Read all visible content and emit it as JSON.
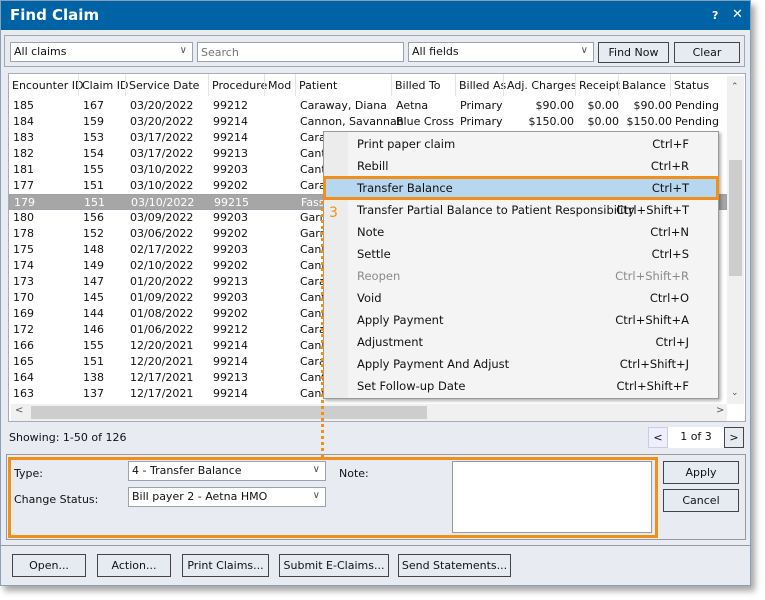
{
  "window": {
    "title": "Find Claim",
    "help": "?",
    "close": "✕"
  },
  "toolbar": {
    "filter": "All claims",
    "search_placeholder": "Search",
    "fields": "All fields",
    "find_now": "Find Now",
    "clear": "Clear"
  },
  "columns": [
    "Encounter ID",
    "Claim ID",
    "Service Date",
    "Procedure",
    "Mod",
    "Patient",
    "Billed To",
    "Billed As",
    "Adj. Charges",
    "Receipt",
    "Balance",
    "Status"
  ],
  "rows": [
    [
      "185",
      "167",
      "03/20/2022",
      "99212",
      "",
      "Caraway, Diana",
      "Aetna",
      "Primary",
      "$90.00",
      "$0.00",
      "$90.00",
      "Pending"
    ],
    [
      "184",
      "159",
      "03/20/2022",
      "99214",
      "",
      "Cannon, Savannah",
      "Blue Cross",
      "Primary",
      "$150.00",
      "$0.00",
      "$150.00",
      "Pending"
    ],
    [
      "183",
      "153",
      "03/17/2022",
      "99214",
      "",
      "Cara"
    ],
    [
      "182",
      "154",
      "03/17/2022",
      "99213",
      "",
      "Cant"
    ],
    [
      "181",
      "155",
      "03/10/2022",
      "99203",
      "",
      "Cant"
    ],
    [
      "177",
      "151",
      "03/10/2022",
      "99202",
      "",
      "Cara"
    ],
    [
      "179",
      "151",
      "03/10/2022",
      "99215",
      "",
      "Fass"
    ],
    [
      "180",
      "156",
      "03/09/2022",
      "99203",
      "",
      "Garr"
    ],
    [
      "178",
      "152",
      "03/06/2022",
      "99202",
      "",
      "Garr"
    ],
    [
      "175",
      "148",
      "02/17/2022",
      "99203",
      "",
      "Cann"
    ],
    [
      "174",
      "149",
      "02/10/2022",
      "99202",
      "",
      "Cann"
    ],
    [
      "173",
      "147",
      "01/20/2022",
      "99213",
      "",
      "Cara"
    ],
    [
      "170",
      "145",
      "01/09/2022",
      "99203",
      "",
      "Cant"
    ],
    [
      "169",
      "144",
      "01/08/2022",
      "99202",
      "",
      "Cant"
    ],
    [
      "172",
      "146",
      "01/06/2022",
      "99212",
      "",
      "Cara"
    ],
    [
      "166",
      "155",
      "12/20/2021",
      "99214",
      "",
      "Cann"
    ],
    [
      "165",
      "151",
      "12/20/2021",
      "99214",
      "",
      "Cara"
    ],
    [
      "164",
      "138",
      "12/17/2021",
      "99213",
      "",
      "Cant"
    ],
    [
      "163",
      "137",
      "12/17/2021",
      "99214",
      "",
      "Cant"
    ]
  ],
  "selected_row": 6,
  "context_menu": [
    {
      "label": "Print paper claim",
      "shortcut": "Ctrl+F"
    },
    {
      "label": "Rebill",
      "shortcut": "Ctrl+R"
    },
    {
      "label": "Transfer Balance",
      "shortcut": "Ctrl+T",
      "highlighted": true
    },
    {
      "label": "Transfer Partial Balance to Patient Responsibility",
      "shortcut": "Ctrl+Shift+T"
    },
    {
      "label": "Note",
      "shortcut": "Ctrl+N"
    },
    {
      "label": "Settle",
      "shortcut": "Ctrl+S"
    },
    {
      "label": "Reopen",
      "shortcut": "Ctrl+Shift+R",
      "disabled": true
    },
    {
      "label": "Void",
      "shortcut": "Ctrl+O"
    },
    {
      "label": "Apply Payment",
      "shortcut": "Ctrl+Shift+A"
    },
    {
      "label": "Adjustment",
      "shortcut": "Ctrl+J"
    },
    {
      "label": "Apply Payment And Adjust",
      "shortcut": "Ctrl+Shift+J"
    },
    {
      "label": "Set Follow-up Date",
      "shortcut": "Ctrl+Shift+F"
    }
  ],
  "callout": {
    "number": "3",
    "color": "#f0901a"
  },
  "status": {
    "showing": "Showing: 1-50 of 126",
    "page": "1 of 3",
    "prev": "<",
    "next": ">"
  },
  "action_panel": {
    "type_label": "Type:",
    "type_value": "4 - Transfer Balance",
    "status_label": "Change Status:",
    "status_value": "Bill payer 2 - Aetna HMO",
    "note_label": "Note:",
    "note_value": "",
    "apply": "Apply",
    "cancel": "Cancel"
  },
  "footer": {
    "open": "Open...",
    "action": "Action...",
    "print": "Print Claims...",
    "submit": "Submit E-Claims...",
    "statements": "Send Statements..."
  }
}
